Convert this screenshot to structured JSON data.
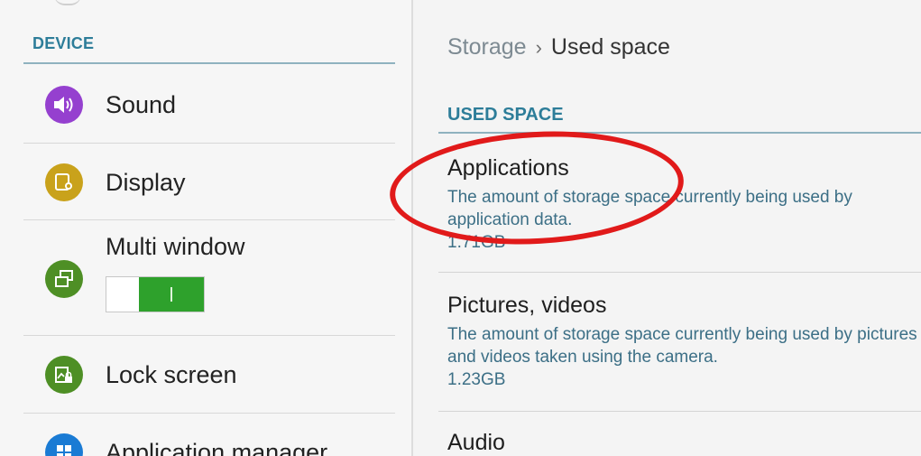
{
  "left": {
    "section_header": "DEVICE",
    "items": [
      {
        "label": "Sound",
        "icon": "speaker-icon",
        "color": "#9540cf"
      },
      {
        "label": "Display",
        "icon": "display-icon",
        "color": "#c9a21b"
      },
      {
        "label": "Multi window",
        "icon": "multi-window-icon",
        "color": "#4e8f25",
        "toggle": "on"
      },
      {
        "label": "Lock screen",
        "icon": "lock-screen-icon",
        "color": "#4e8f25"
      },
      {
        "label": "Application manager",
        "icon": "grid-icon",
        "color": "#1a7bd4"
      }
    ]
  },
  "right": {
    "breadcrumb": {
      "parent": "Storage",
      "separator": "›",
      "current": "Used space"
    },
    "section_header": "USED SPACE",
    "entries": [
      {
        "title": "Applications",
        "description": "The amount of storage space currently being used by application data.",
        "size": "1.71GB"
      },
      {
        "title": "Pictures, videos",
        "description": "The amount of storage space currently being used by pictures and videos taken using the camera.",
        "size": "1.23GB"
      },
      {
        "title": "Audio"
      }
    ]
  },
  "colors": {
    "accent": "#2d7d99",
    "toggle_on": "#2ea12c",
    "annotation": "#e11a1a"
  }
}
